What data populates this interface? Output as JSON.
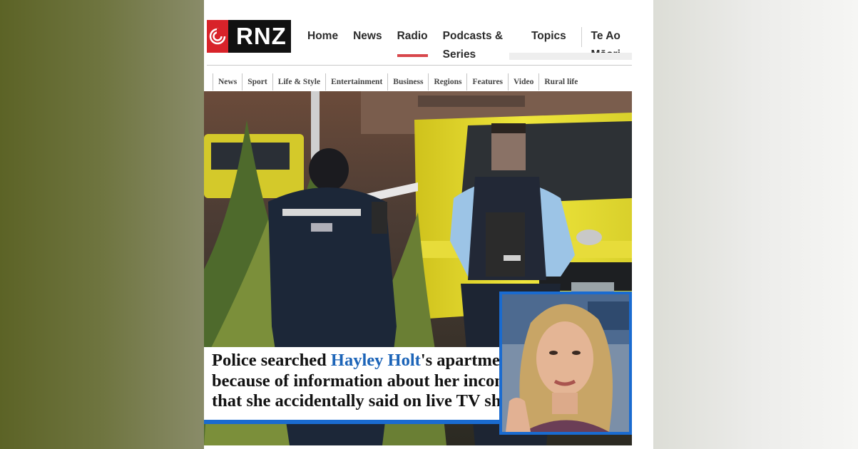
{
  "site": {
    "logo_text": "RNZ",
    "brand_color": "#d8232a"
  },
  "main_nav": {
    "items": [
      {
        "label": "Home"
      },
      {
        "label": "News"
      },
      {
        "label": "Radio",
        "active": true
      },
      {
        "label": "Podcasts & Series"
      },
      {
        "label": "Topics"
      }
    ],
    "extra": "Te Ao Māori"
  },
  "sub_nav": {
    "tabs": [
      "News",
      "Sport",
      "Life & Style",
      "Entertainment",
      "Business",
      "Regions",
      "Features",
      "Video",
      "Rural life"
    ]
  },
  "caption": {
    "line1_before": "Police searched ",
    "line1_name": "Hayley Holt",
    "line1_after": "'s apartment",
    "line2": "because of information about her income",
    "line3": "that she accidentally said on live TV show",
    "highlight_color": "#1c64b8",
    "frame_color": "#1a6bd0"
  },
  "images": {
    "hero": "police-officers-armed-near-ambulance-photo",
    "inset": "woman-blonde-tv-presenter-photo"
  }
}
